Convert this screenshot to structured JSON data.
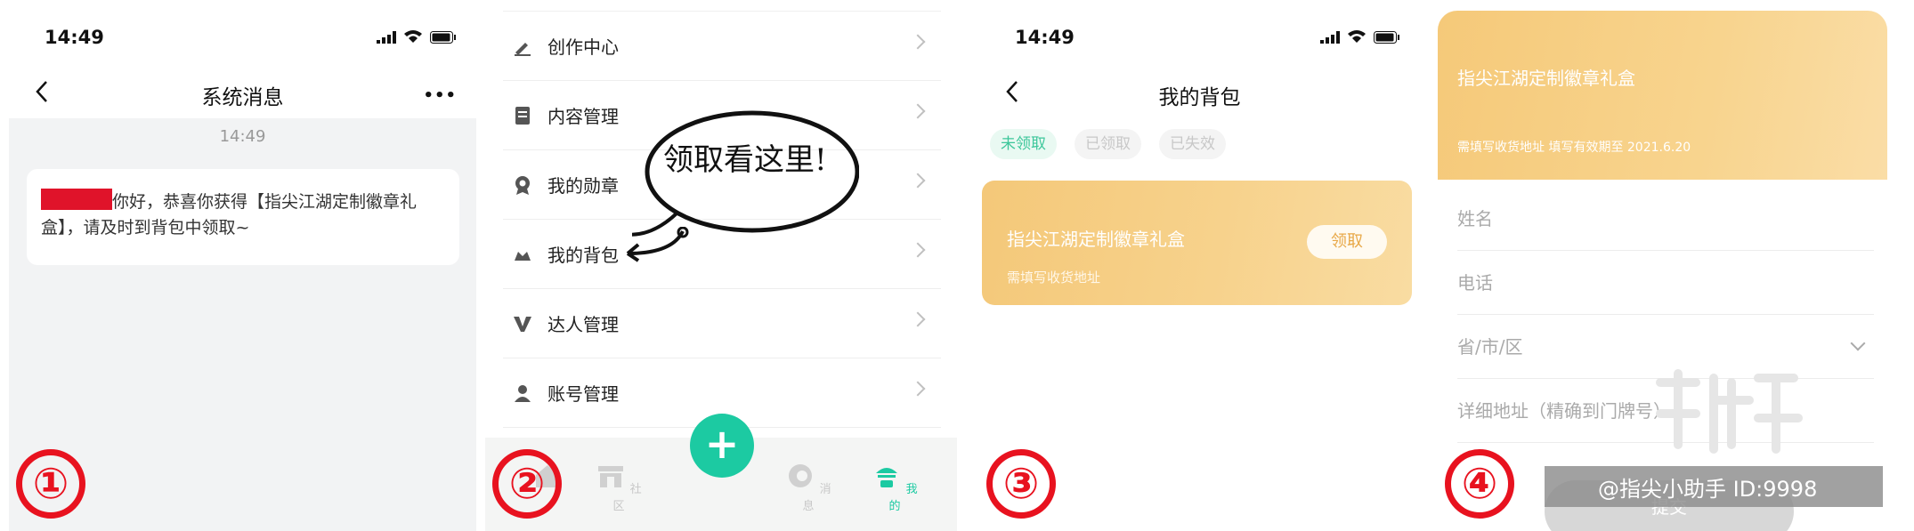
{
  "colors": {
    "accent_green": "#1ccaa2",
    "badge_red": "#e8121f",
    "gift_gold": "#f5c979"
  },
  "panel1": {
    "status_time": "14:49",
    "title": "系统消息",
    "more_icon": "more-icon",
    "message_time": "14:49",
    "message_text": "你好，恭喜你获得【指尖江湖定制徽章礼盒】，请及时到背包中领取~",
    "step": "①"
  },
  "panel2": {
    "menu": [
      {
        "label": "创作中心",
        "icon": "pen-icon"
      },
      {
        "label": "内容管理",
        "icon": "document-icon"
      },
      {
        "label": "我的勋章",
        "icon": "medal-icon"
      },
      {
        "label": "我的背包",
        "icon": "backpack-icon"
      },
      {
        "label": "达人管理",
        "icon": "v-badge-icon"
      },
      {
        "label": "账号管理",
        "icon": "user-icon"
      }
    ],
    "annotation": "领取看这里!",
    "tabs": [
      {
        "label": "",
        "icon": "home-icon"
      },
      {
        "label": "社区",
        "icon": "community-icon"
      },
      {
        "label": "+",
        "icon": "plus-icon"
      },
      {
        "label": "消息",
        "icon": "message-icon"
      },
      {
        "label": "我的",
        "icon": "profile-icon"
      }
    ],
    "step": "②"
  },
  "panel3": {
    "status_time": "14:49",
    "title": "我的背包",
    "filters": [
      "未领取",
      "已领取",
      "已失效"
    ],
    "gift": {
      "title": "指尖江湖定制徽章礼盒",
      "subtitle": "需填写收货地址",
      "button": "领取"
    },
    "step": "③"
  },
  "panel4": {
    "title": "指尖江湖定制徽章礼盒",
    "subtitle": "需填写收货地址  填写有效期至 2021.6.20",
    "fields": [
      {
        "placeholder": "姓名"
      },
      {
        "placeholder": "电话"
      },
      {
        "placeholder": "省/市/区"
      },
      {
        "placeholder": "详细地址（精确到门牌号）"
      }
    ],
    "submit": "提交",
    "watermark_banner": "@指尖小助手  ID:9998",
    "step": "④"
  }
}
